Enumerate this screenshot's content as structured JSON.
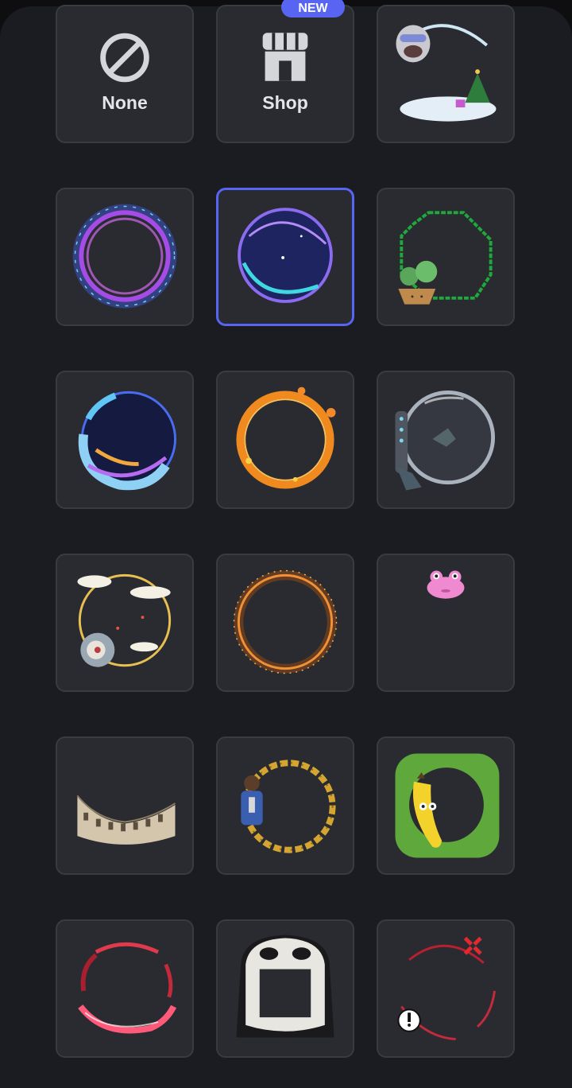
{
  "decorations": {
    "none_label": "None",
    "shop_label": "Shop",
    "new_badge": "NEW",
    "selected_index": 4,
    "items": [
      {
        "name": "none",
        "icon": "circle-slash-icon"
      },
      {
        "name": "shop",
        "icon": "storefront-icon"
      },
      {
        "name": "winter-yeti-frame"
      },
      {
        "name": "purple-vortex-ring"
      },
      {
        "name": "cosmic-orb-ring"
      },
      {
        "name": "pixel-plant-frame"
      },
      {
        "name": "wave-orb-ring"
      },
      {
        "name": "orange-flower-ring"
      },
      {
        "name": "glass-bubble-ring"
      },
      {
        "name": "cloud-gold-ring"
      },
      {
        "name": "sparkle-fire-ring"
      },
      {
        "name": "pink-frog"
      },
      {
        "name": "colosseum-crown"
      },
      {
        "name": "gold-chain-ring"
      },
      {
        "name": "banana-grass-frame"
      },
      {
        "name": "red-flame-ring"
      },
      {
        "name": "ghost-mask-frame"
      },
      {
        "name": "angry-red-ring"
      }
    ]
  },
  "colors": {
    "accent": "#5865f2",
    "tile_bg": "#2a2b31",
    "sheet_bg": "#1b1c21"
  }
}
